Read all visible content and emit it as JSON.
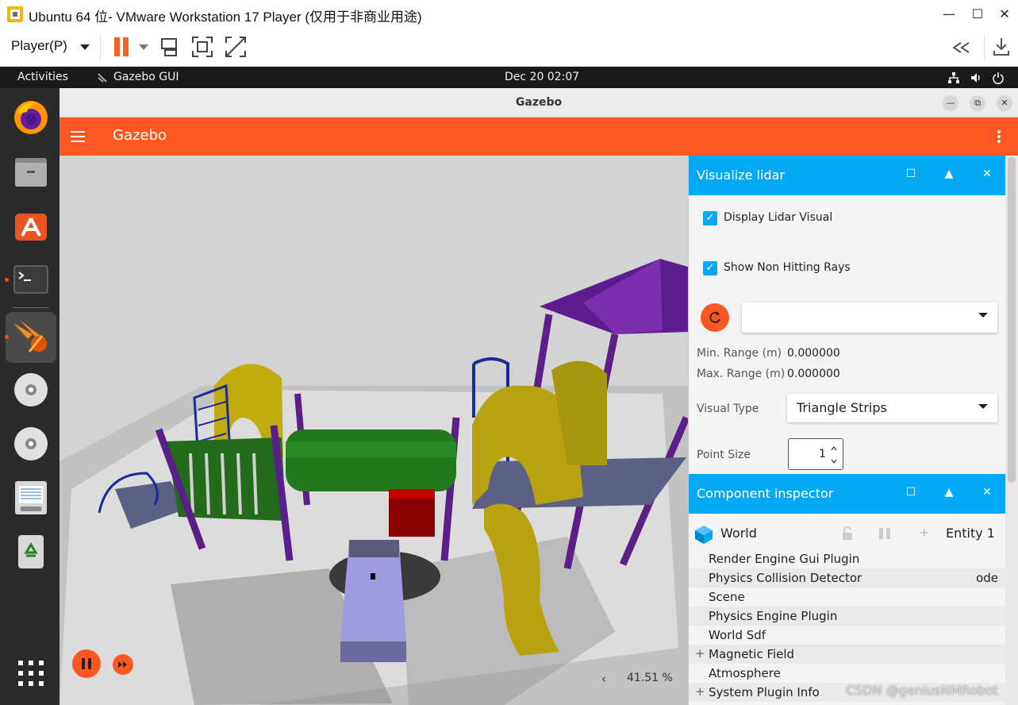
{
  "vmware": {
    "title": "Ubuntu 64 位- VMware Workstation 17 Player (仅用于非商业用途)",
    "menu_label": "Player(P)",
    "minimize_glyph": "—",
    "maximize_glyph": "☐",
    "close_glyph": "✕"
  },
  "ubuntu_topbar": {
    "activities": "Activities",
    "app_name": "Gazebo GUI",
    "clock": "Dec 20  02:07"
  },
  "dock": {
    "items": [
      "firefox-icon",
      "files-icon",
      "app-store-icon",
      "terminal-icon",
      "gazebo-icon",
      "disc-icon",
      "disc-icon",
      "document-icon",
      "trash-icon",
      "app-grid-icon"
    ]
  },
  "gazebo": {
    "window_title": "Gazebo",
    "app_title": "Gazebo",
    "zoom": "41.51 %",
    "nav_prev_glyph": "‹"
  },
  "lidar_panel": {
    "title": "Visualize lidar",
    "display_lidar_label": "Display Lidar Visual",
    "display_lidar_checked": true,
    "show_non_hitting_label": "Show Non Hitting Rays",
    "show_non_hitting_checked": true,
    "topic_value": "",
    "min_range_label": "Min. Range (m)",
    "min_range_value": "0.000000",
    "max_range_label": "Max. Range (m)",
    "max_range_value": "0.000000",
    "visual_type_label": "Visual Type",
    "visual_type_value": "Triangle Strips",
    "point_size_label": "Point Size",
    "point_size_value": "1"
  },
  "inspector": {
    "title": "Component inspector",
    "entity_name": "World",
    "entity_id": "Entity 1",
    "components": [
      {
        "label": "Render Engine Gui Plugin",
        "value": "",
        "expandable": false
      },
      {
        "label": "Physics Collision Detector",
        "value": "ode",
        "expandable": false
      },
      {
        "label": "Scene",
        "value": "",
        "expandable": false
      },
      {
        "label": "Physics Engine Plugin",
        "value": "",
        "expandable": false
      },
      {
        "label": "World Sdf",
        "value": "",
        "expandable": false
      },
      {
        "label": "Magnetic Field",
        "value": "",
        "expandable": true
      },
      {
        "label": "Atmosphere",
        "value": "",
        "expandable": false
      },
      {
        "label": "System Plugin Info",
        "value": "",
        "expandable": true
      }
    ]
  },
  "watermark": "CSDN @geniusNMRobot",
  "colors": {
    "gazebo_accent": "#ff5722",
    "panel_header": "#03a9f4",
    "dock_bg": "#2b2b2b",
    "topbar_bg": "#1a1a1a"
  }
}
